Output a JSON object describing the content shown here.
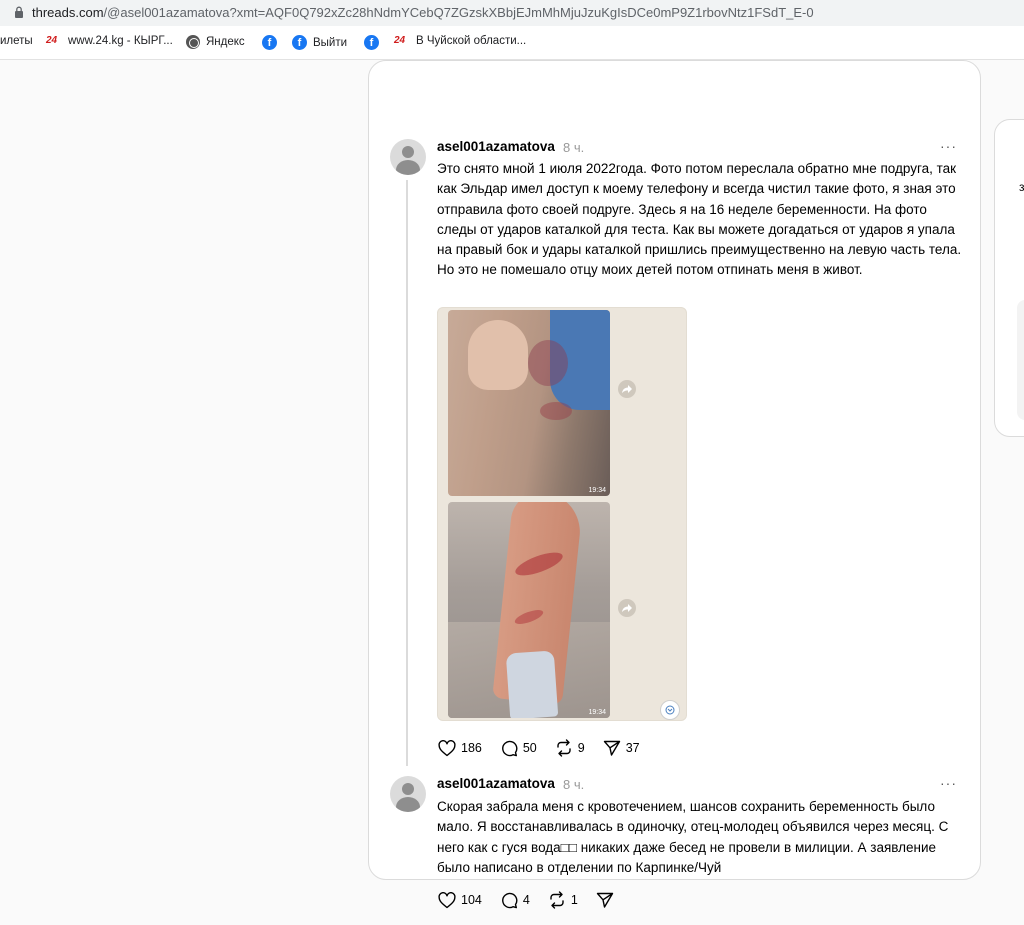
{
  "browser": {
    "url_host": "threads.com",
    "url_path": "/@asel001azamatova?xmt=AQF0Q792xZc28hNdmYCebQ7ZGzskXBbjEJmMhMjuJzuKgIsDCe0mP9Z1rbovNtz1FSdT_E-0",
    "bookmarks": [
      {
        "label": "илеты"
      },
      {
        "label": "www.24.kg - КЫРГ..."
      },
      {
        "label": "Яндекс"
      },
      {
        "label": ""
      },
      {
        "label": "Выйти"
      },
      {
        "label": ""
      },
      {
        "label": "В Чуйской области..."
      }
    ]
  },
  "header": {
    "title": "asel001azamatova"
  },
  "side_card": {
    "text": "з"
  },
  "posts": [
    {
      "username": "asel001azamatova",
      "time": "8 ч.",
      "text": "Это снято мной 1 июля 2022года. Фото потом переслала обратно мне подруга, так как Эльдар имел доступ к моему телефону и всегда чистил такие фото, я зная это отправила фото своей подруге. Здесь я на 16 неделе беременности. На фото следы от ударов каталкой для теста. Как вы можете догадаться от ударов я упала на правый бок и удары каталкой пришлись преимущественно на левую часть тела. Но это не помешало отцу моих детей потом отпинать меня в живот.",
      "image_timestamps": [
        "19:34",
        "19:34"
      ],
      "likes": "186",
      "comments": "50",
      "reposts": "9",
      "shares": "37"
    },
    {
      "username": "asel001azamatova",
      "time": "8 ч.",
      "text": "Скорая забрала меня с кровотечением, шансов сохранить беременность было мало. Я восстанавливалась в одиночку, отец-молодец объявился через месяц. С него как с гуся вода□□ никаких даже бесед не провели в милиции. А заявление было написано в отделении по Карпинке/Чуй",
      "likes": "104",
      "comments": "4",
      "reposts": "1"
    }
  ]
}
